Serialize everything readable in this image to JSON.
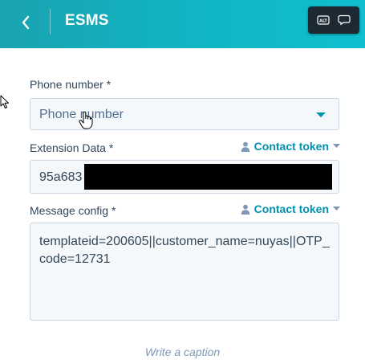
{
  "header": {
    "title": "ESMS",
    "colors": {
      "start": "#1aa3b0",
      "end": "#0fbfcf"
    },
    "back_icon": "chevron-left-icon",
    "toolbar": {
      "alt_label": "ALT",
      "alt_icon": "alt-text-icon",
      "comment_icon": "speech-bubble-icon"
    }
  },
  "form": {
    "phone": {
      "label": "Phone number *",
      "placeholder": "Phone number",
      "dropdown_icon": "caret-down-icon"
    },
    "extension": {
      "label": "Extension Data *",
      "token_label": "Contact token",
      "value_visible": "95a683"
    },
    "message": {
      "label": "Message config *",
      "token_label": "Contact token",
      "value": "templateid=200605||customer_name=nuyas||OTP_code=12731"
    }
  },
  "caption": {
    "placeholder": "Write a caption"
  },
  "accent_color": "#0091ae"
}
